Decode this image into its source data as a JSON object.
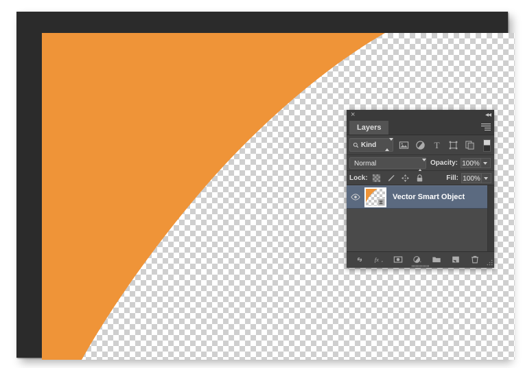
{
  "document": {
    "background_color": "#ffffff",
    "frame_color": "#2b2b2b",
    "canvas": {
      "transparency_checker_light": "#ffffff",
      "transparency_checker_dark": "#cfcfcf",
      "shape_color": "#ef9438",
      "shape_description": "orange-concave-curve"
    }
  },
  "layers_panel": {
    "title_bar": {
      "close_label": "×",
      "close_icon": "close-icon",
      "collapse_label": "◂◂",
      "collapse_icon": "collapse-panel-icon"
    },
    "tabs": [
      {
        "label": "Layers",
        "active": true
      }
    ],
    "menu_icon": "panel-menu-icon",
    "filter": {
      "search_icon": "search-icon",
      "kind_label": "Kind",
      "stepper_icon": "updown-stepper-icon",
      "icons": [
        {
          "name": "filter-pixel-layers-icon",
          "tooltip": "Pixel"
        },
        {
          "name": "filter-adjustment-layers-icon",
          "tooltip": "Adjustment"
        },
        {
          "name": "filter-type-layers-icon",
          "tooltip": "Type"
        },
        {
          "name": "filter-shape-layers-icon",
          "tooltip": "Shape"
        },
        {
          "name": "filter-smart-object-layers-icon",
          "tooltip": "Smart Object"
        }
      ],
      "toggle_icon": "filter-enable-toggle"
    },
    "blend": {
      "mode": "Normal",
      "mode_stepper_icon": "updown-stepper-icon",
      "opacity_label": "Opacity:",
      "opacity_value": "100%",
      "opacity_arrow_icon": "chevron-down-icon"
    },
    "lock": {
      "label": "Lock:",
      "icons": [
        {
          "name": "lock-transparent-pixels-icon"
        },
        {
          "name": "lock-image-pixels-icon"
        },
        {
          "name": "lock-position-icon"
        },
        {
          "name": "lock-all-icon"
        }
      ],
      "fill_label": "Fill:",
      "fill_value": "100%",
      "fill_arrow_icon": "chevron-down-icon"
    },
    "layers": [
      {
        "name": "Vector Smart Object",
        "visible": true,
        "selected": true,
        "visibility_icon": "eye-icon",
        "thumbnail": "layer-thumbnail-vector-smart-object",
        "badge_icon": "smart-object-badge-icon"
      }
    ],
    "selected_row_color": "#5b6a80",
    "toolbar": [
      {
        "name": "link-layers-button",
        "icon": "link-icon"
      },
      {
        "name": "layer-style-button",
        "icon": "fx-icon"
      },
      {
        "name": "add-layer-mask-button",
        "icon": "mask-icon"
      },
      {
        "name": "new-adjustment-layer-button",
        "icon": "adjustment-icon"
      },
      {
        "name": "new-group-button",
        "icon": "folder-icon"
      },
      {
        "name": "new-layer-button",
        "icon": "new-layer-icon"
      },
      {
        "name": "delete-layer-button",
        "icon": "trash-icon"
      }
    ],
    "resize_grip_icon": "resize-grip-icon"
  }
}
